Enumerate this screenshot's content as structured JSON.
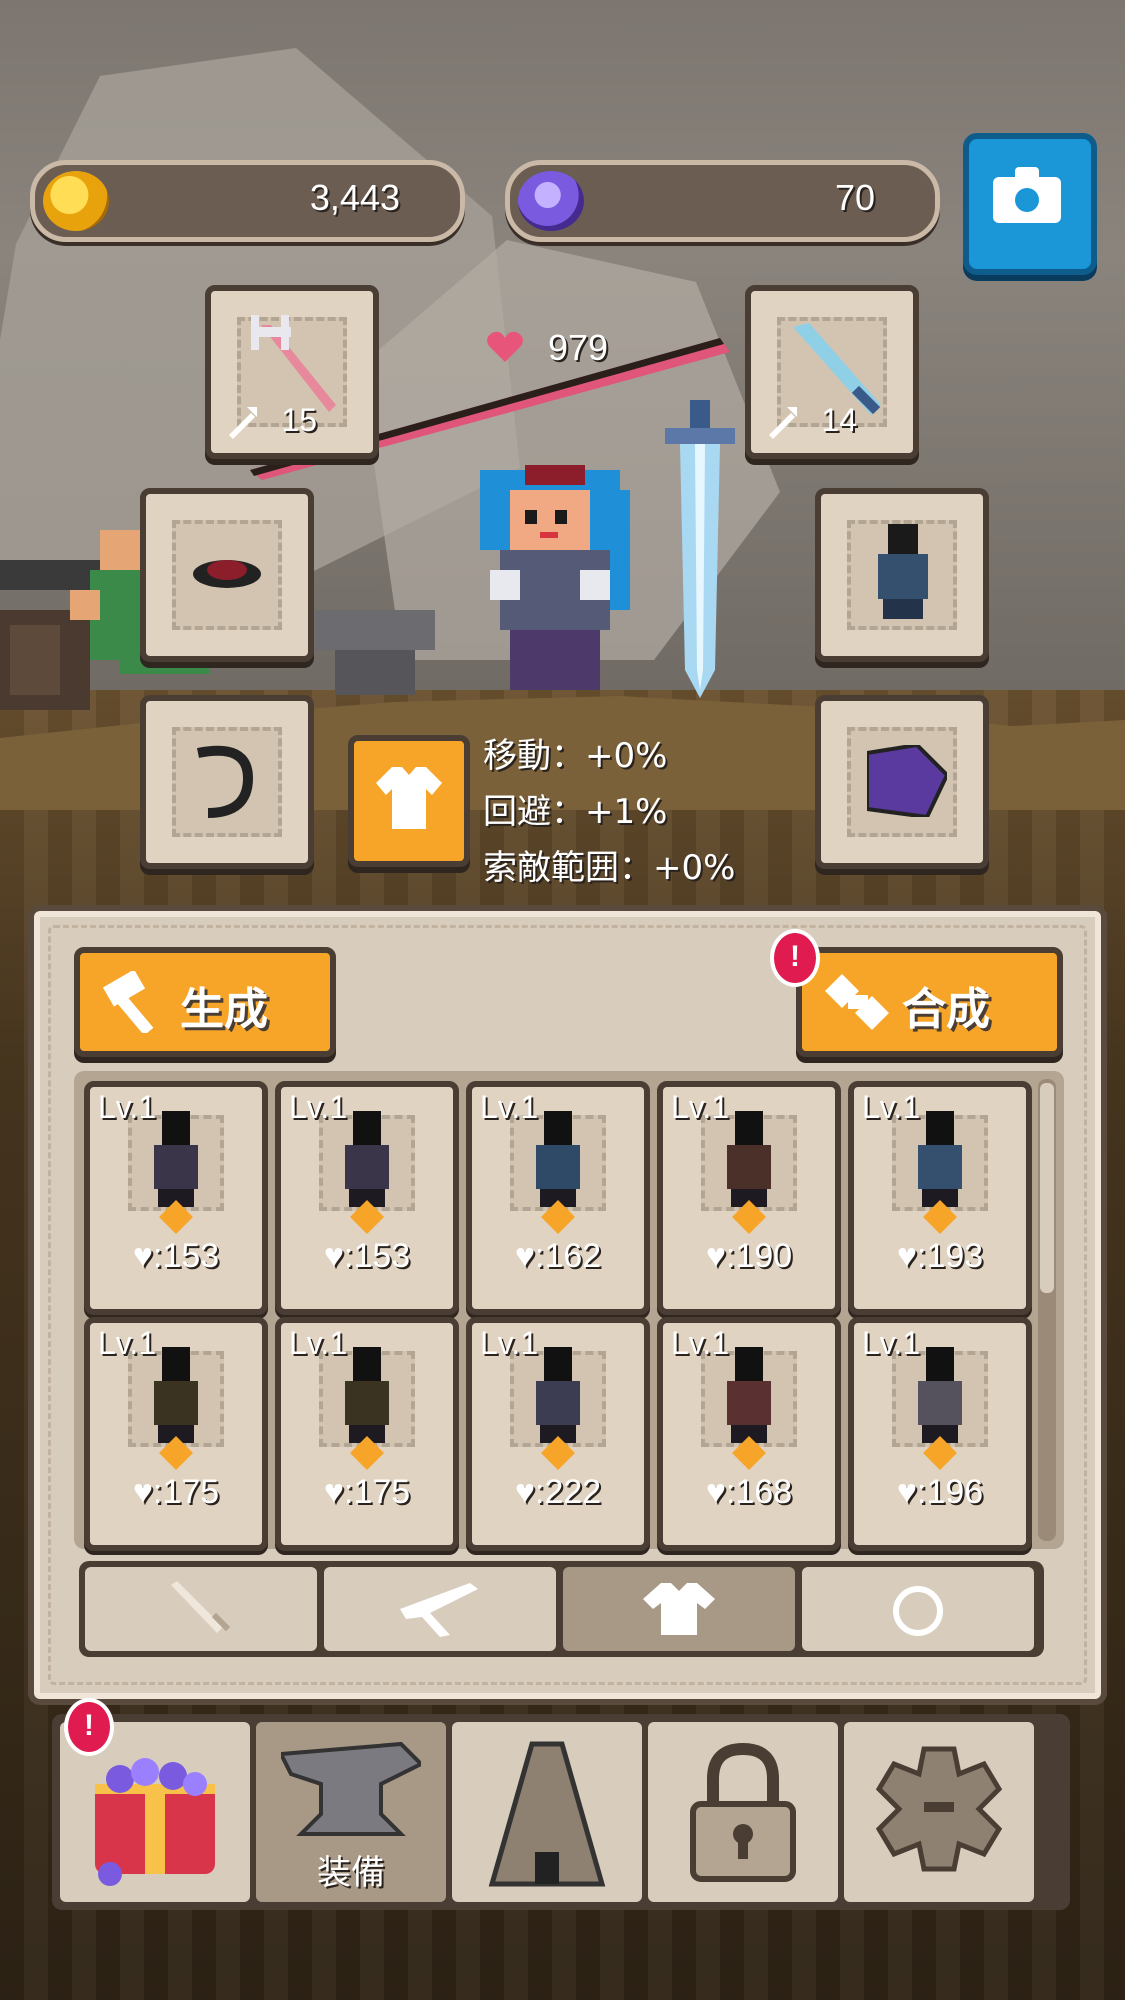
{
  "currencies": {
    "coins": "3,443",
    "gems": "70"
  },
  "player": {
    "hp": "979"
  },
  "slots": {
    "weapon_left_count": "15",
    "weapon_right_count": "14"
  },
  "stats": {
    "move": "移動：+0%",
    "evade": "回避：+1%",
    "search": "索敵範囲：+0%"
  },
  "actions": {
    "generate": "生成",
    "combine": "合成",
    "badge": "!"
  },
  "items": [
    {
      "lv": "Lv.1",
      "hp": "♥:153",
      "color": "#3a3548"
    },
    {
      "lv": "Lv.1",
      "hp": "♥:153",
      "color": "#3a3548"
    },
    {
      "lv": "Lv.1",
      "hp": "♥:162",
      "color": "#2f4a66"
    },
    {
      "lv": "Lv.1",
      "hp": "♥:190",
      "color": "#4a3028"
    },
    {
      "lv": "Lv.1",
      "hp": "♥:193",
      "color": "#35506e"
    },
    {
      "lv": "Lv.1",
      "hp": "♥:175",
      "color": "#3b3322"
    },
    {
      "lv": "Lv.1",
      "hp": "♥:175",
      "color": "#3b3322"
    },
    {
      "lv": "Lv.1",
      "hp": "♥:222",
      "color": "#3c3d52"
    },
    {
      "lv": "Lv.1",
      "hp": "♥:168",
      "color": "#5a3030"
    },
    {
      "lv": "Lv.1",
      "hp": "♥:196",
      "color": "#55525e"
    }
  ],
  "tabs": [
    "sword-icon",
    "bow-icon",
    "armor-icon",
    "ring-icon"
  ],
  "nav": {
    "equip_label": "装備",
    "badge": "!"
  },
  "colors": {
    "accent": "#f7a529",
    "panel": "#d8ccbd",
    "border": "#4a3d33",
    "camera": "#1b97d8",
    "badge": "#e01b4f"
  }
}
